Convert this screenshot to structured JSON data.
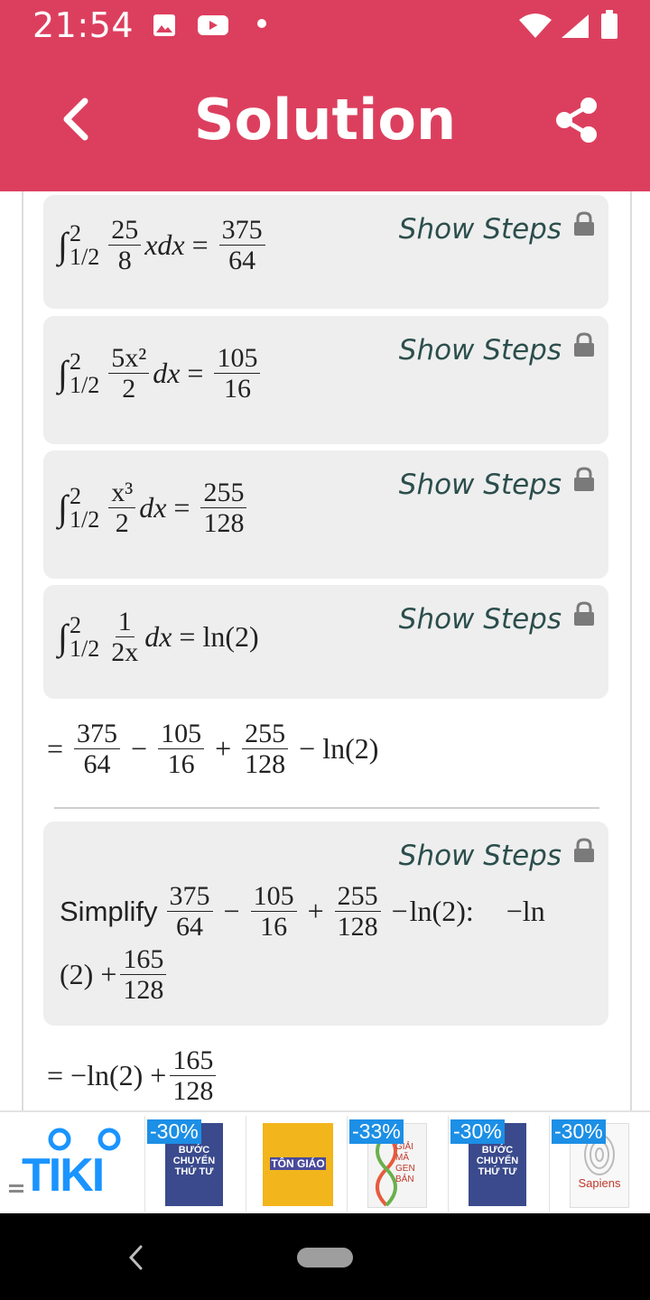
{
  "status": {
    "time": "21:54"
  },
  "appbar": {
    "title": "Solution"
  },
  "show_steps_label": "Show Steps",
  "cards": [
    {
      "upper": "2",
      "lower": "1/2",
      "num": "25",
      "den": "8",
      "after": "xdx",
      "r_num": "375",
      "r_den": "64"
    },
    {
      "upper": "2",
      "lower": "1/2",
      "num": "5x²",
      "den": "2",
      "after": "dx",
      "r_num": "105",
      "r_den": "16"
    },
    {
      "upper": "2",
      "lower": "1/2",
      "num": "x³",
      "den": "2",
      "after": "dx",
      "r_num": "255",
      "r_den": "128"
    },
    {
      "upper": "2",
      "lower": "1/2",
      "num": "1",
      "den": "2x",
      "after": "dx",
      "result": "ln(2)"
    }
  ],
  "sum_line": {
    "f1_num": "375",
    "f1_den": "64",
    "op1": "−",
    "f2_num": "105",
    "f2_den": "16",
    "op2": "+",
    "f3_num": "255",
    "f3_den": "128",
    "op3": "−",
    "tail": "ln(2)"
  },
  "simplify": {
    "label": "Simplify",
    "f1_num": "375",
    "f1_den": "64",
    "op1": "−",
    "f2_num": "105",
    "f2_den": "16",
    "op2": "+",
    "f3_num": "255",
    "f3_den": "128",
    "op3": "−",
    "tail": "ln(2):",
    "res_a": "−ln",
    "res_b": "(2) +",
    "res_num": "165",
    "res_den": "128"
  },
  "final_line": {
    "prefix": "= −ln(2) +",
    "num": "165",
    "den": "128"
  },
  "ads": {
    "brand": "TIKI",
    "items": [
      {
        "badge": "-30%",
        "title": "BƯỚC CHUYỂN THỨ TƯ",
        "color": "#3a4a8c"
      },
      {
        "badge": "",
        "title": "TÔN GIÁO",
        "color": "#f2b51c"
      },
      {
        "badge": "-33%",
        "title": "GIẢI MÃ GEN BẢN",
        "color": "#f4f4f4"
      },
      {
        "badge": "-30%",
        "title": "BƯỚC CHUYỂN THỨ TƯ",
        "color": "#3a4a8c"
      },
      {
        "badge": "-30%",
        "title": "Sapiens",
        "color": "#f8f8f8"
      }
    ]
  }
}
